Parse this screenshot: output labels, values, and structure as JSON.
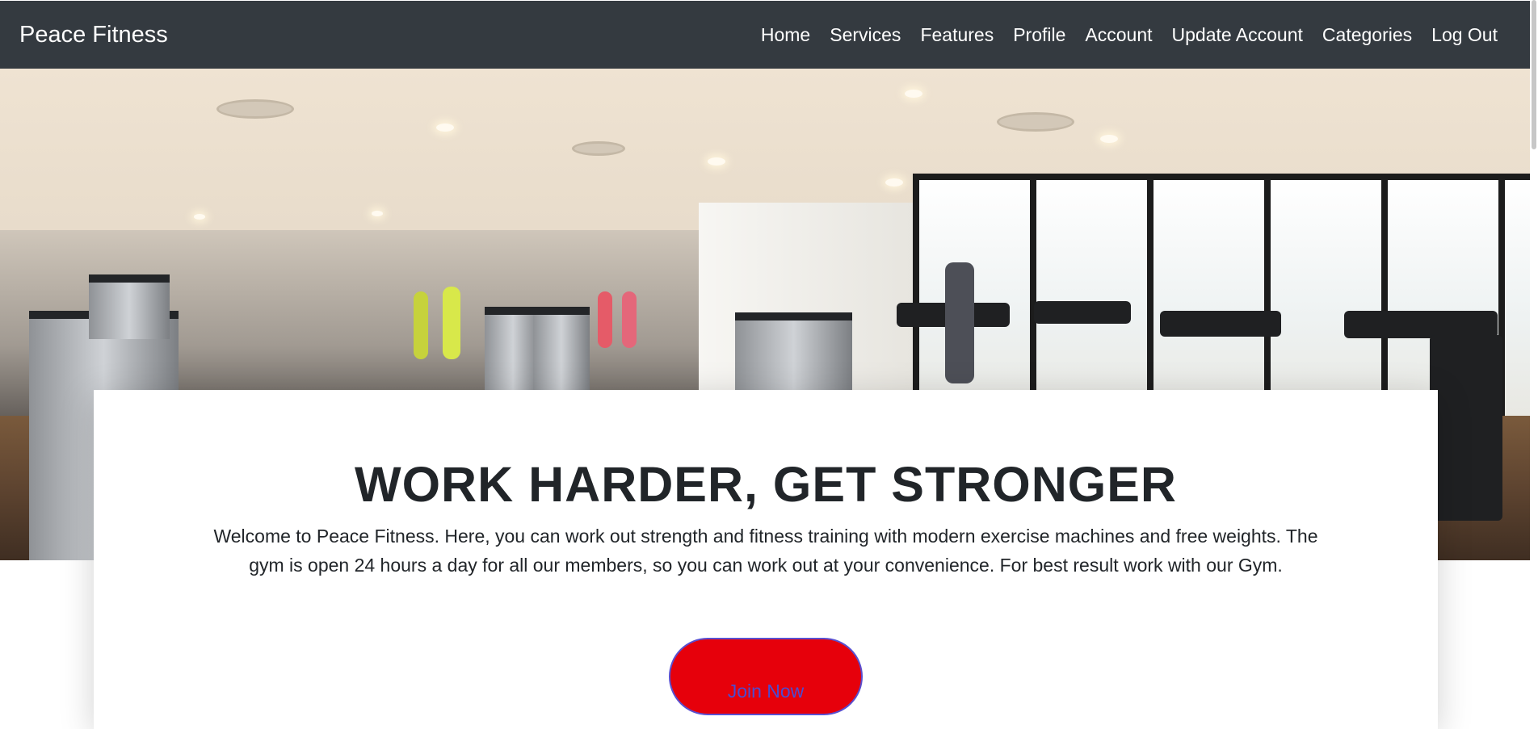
{
  "navbar": {
    "brand": "Peace Fitness",
    "links": [
      "Home",
      "Services",
      "Features",
      "Profile",
      "Account",
      "Update Account",
      "Categories",
      "Log Out"
    ]
  },
  "hero": {
    "image": "gym-interior-photo"
  },
  "card": {
    "headline": "WORK HARDER, GET STRONGER",
    "description": "Welcome to Peace Fitness. Here, you can work out strength and fitness training with modern exercise machines and free weights. The gym is open 24 hours a day for all our members, so you can work out at your convenience. For best result work with our Gym.",
    "button_label": "Join Now"
  },
  "colors": {
    "navbar_bg": "#343a40",
    "button_bg": "#e6000b",
    "button_text": "#4d4bd0"
  }
}
